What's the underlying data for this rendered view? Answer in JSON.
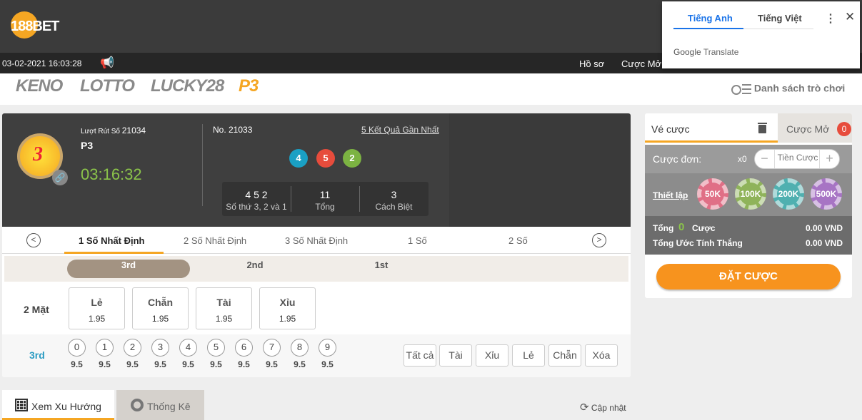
{
  "header": {
    "logo_text": "188BET",
    "datetime": "03-02-2021 16:03:28",
    "profile_label": "Hồ sơ",
    "open_bets_label": "Cược Mở"
  },
  "game_tabs": [
    {
      "label": "KENO",
      "active": false
    },
    {
      "label": "LOTTO",
      "active": false
    },
    {
      "label": "LUCKY28",
      "active": false
    },
    {
      "label": "P3",
      "active": true
    }
  ],
  "game_list_label": "Danh sách trò chơi",
  "draw": {
    "draw_label": "Lượt Rút Số",
    "draw_number": "21034",
    "game_name": "P3",
    "countdown": "03:16:32",
    "logo_text": "3",
    "prev_no": "No. 21033",
    "recent_results_label": "5 Kết Quả Gần Nhất",
    "balls": [
      {
        "value": "4",
        "color": "#1aa0c4"
      },
      {
        "value": "5",
        "color": "#e74c3c"
      },
      {
        "value": "2",
        "color": "#7cb342"
      }
    ],
    "summary": [
      {
        "value": "4 5 2",
        "label": "Số thứ 3, 2 và 1"
      },
      {
        "value": "11",
        "label": "Tổng"
      },
      {
        "value": "3",
        "label": "Cách Biệt"
      }
    ]
  },
  "bet_type_tabs": [
    {
      "label": "1 Số Nhất Định",
      "active": true
    },
    {
      "label": "2 Số Nhất Định",
      "active": false
    },
    {
      "label": "3 Số Nhất Định",
      "active": false
    },
    {
      "label": "1 Số",
      "active": false
    },
    {
      "label": "2 Số",
      "active": false
    }
  ],
  "position_tabs": [
    {
      "label": "3rd",
      "active": true
    },
    {
      "label": "2nd",
      "active": false
    },
    {
      "label": "1st",
      "active": false
    }
  ],
  "two_sided": {
    "label": "2 Mặt",
    "options": [
      {
        "name": "Lẻ",
        "odds": "1.95"
      },
      {
        "name": "Chẵn",
        "odds": "1.95"
      },
      {
        "name": "Tài",
        "odds": "1.95"
      },
      {
        "name": "Xỉu",
        "odds": "1.95"
      }
    ]
  },
  "digits": {
    "row_label": "3rd",
    "numbers": [
      "0",
      "1",
      "2",
      "3",
      "4",
      "5",
      "6",
      "7",
      "8",
      "9"
    ],
    "odds": "9.5",
    "quick_buttons": [
      "Tất cả",
      "Tài",
      "Xỉu",
      "Lẻ",
      "Chẵn",
      "Xóa"
    ]
  },
  "betslip": {
    "tab_label": "Vé cược",
    "open_tab_label": "Cược Mở",
    "open_count": "0",
    "single_label": "Cược đơn:",
    "single_count": "x0",
    "stake_placeholder": "Tiền Cược",
    "settings_label": "Thiết lập",
    "chips": [
      {
        "label": "50K",
        "color": "#e06f86"
      },
      {
        "label": "100K",
        "color": "#8fb35a"
      },
      {
        "label": "200K",
        "color": "#4fb0b0"
      },
      {
        "label": "500K",
        "color": "#a774c4"
      }
    ],
    "total_label": "Tổng",
    "total_count": "0",
    "total_bet_label": "Cược",
    "total_amount": "0.00 VND",
    "est_win_label": "Tổng Ước Tính Thắng",
    "est_win_amount": "0.00 VND",
    "place_bet_label": "ĐẶT CƯỢC"
  },
  "bottom_tabs": {
    "trend_label": "Xem Xu Hướng",
    "stats_label": "Thống Kê",
    "refresh_label": "Cập nhật"
  },
  "translate_popup": {
    "lang_en": "Tiếng Anh",
    "lang_vi": "Tiếng Việt",
    "google": "Google",
    "translate": "Translate"
  }
}
